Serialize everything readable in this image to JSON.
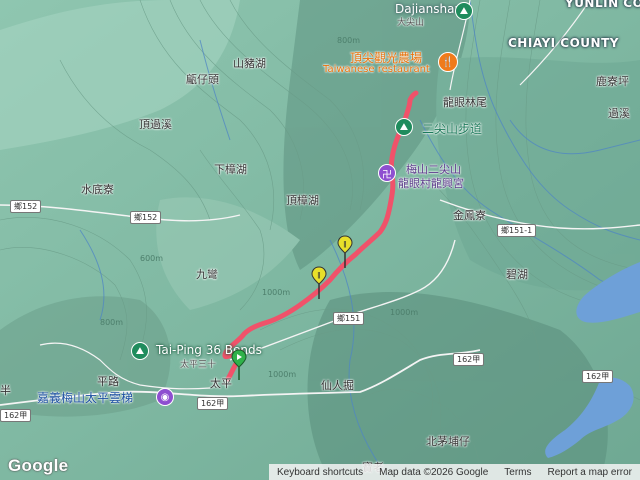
{
  "map": {
    "labels": {
      "dajianshan_en": "Dajianshan",
      "dajianshan_zh": "大尖山",
      "yunlin": "YUNLIN CO",
      "chiayi": "CHIAYI COUNTY",
      "restaurant_zh": "頂尖觀光農場",
      "restaurant_en": "Taiwanese restaurant",
      "shanzhuhu": "山豬湖",
      "bizaitou": "甂仔頭",
      "longyanlinwei": "龍眼林尾",
      "luliaoping": "鹿寮坪",
      "guoxi": "過溪",
      "dingnaoxi": "頂過溪",
      "trail": "二尖山步道",
      "xiazhanghu": "下樟湖",
      "temple_1": "梅山二尖山",
      "temple_2": "龍眼村龍興宮",
      "shuidiliao": "水底寮",
      "dingzhanghu": "頂樟湖",
      "jinfengliao": "金鳳寮",
      "jiuwan": "九彎",
      "bihu": "碧湖",
      "taiping_en": "Tai-Ping 36 Bends",
      "taiping_sanshi": "太平三十",
      "taiping": "太平",
      "pinglu": "平路",
      "ban": "半",
      "skybridge": "嘉義梅山太平雲梯",
      "xianrenjue": "仙人掘",
      "beimao": "北茅埔仔",
      "baolao": "寶老"
    },
    "roads": {
      "r152a": "鄉152",
      "r152b": "鄉152",
      "r151_1": "鄉151-1",
      "r151": "鄉151",
      "r162a": "162甲",
      "r162b": "162甲",
      "r162c": "162甲",
      "r162d": "162甲"
    },
    "contours": {
      "c1": "800m",
      "c2": "600m",
      "c3": "800m",
      "c4": "1000m",
      "c5": "1000m",
      "c6": "1000m"
    },
    "route_color": "#f0526a"
  },
  "branding": {
    "logo": "Google"
  },
  "footer": {
    "shortcuts": "Keyboard shortcuts",
    "mapdata": "Map data ©2026 Google",
    "terms": "Terms",
    "report": "Report a map error"
  }
}
